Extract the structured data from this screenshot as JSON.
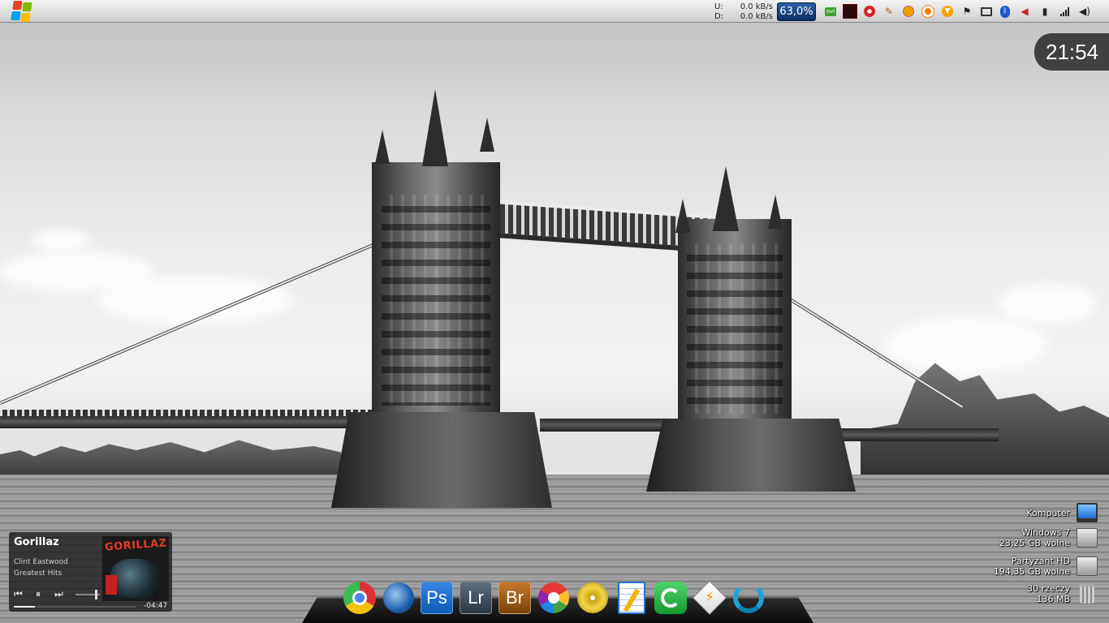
{
  "topbar": {
    "upload_label": "U:",
    "upload_speed": "0.0 kB/s",
    "download_label": "D:",
    "download_speed": "0.0 kB/s",
    "cpu_usage": "63,0%",
    "ovi_label": "ovi",
    "tray_icons": [
      "ovi-icon",
      "cpu-graph-icon",
      "antivirus-icon",
      "tools-icon",
      "coin-icon",
      "orange-sync-icon",
      "download-arrow-icon",
      "flag-icon",
      "network-icon",
      "bluetooth-icon",
      "volume-icon",
      "power-icon",
      "signal-icon",
      "speaker-icon"
    ]
  },
  "clock": {
    "time": "21:54"
  },
  "desktop_icons": [
    {
      "lines": [
        "Komputer"
      ],
      "icon": "monitor-icon"
    },
    {
      "lines": [
        "Windows 7",
        "23,25 GB wolne"
      ],
      "icon": "hard-drive-icon"
    },
    {
      "lines": [
        "Partyzant HD",
        "194,35 GB wolne"
      ],
      "icon": "hard-drive-icon"
    },
    {
      "lines": [
        "30 rzeczy",
        "136 MB"
      ],
      "icon": "recycle-bin-icon"
    }
  ],
  "player": {
    "artist": "Gorillaz",
    "track": "Clint Eastwood",
    "album": "Greatest Hits",
    "time_remaining": "-04:47",
    "cover_text": "GORILLAZ",
    "progress": 0.17
  },
  "dock": [
    {
      "name": "chrome-icon",
      "label": ""
    },
    {
      "name": "thunderbird-icon",
      "label": ""
    },
    {
      "name": "photoshop-icon",
      "label": "Ps"
    },
    {
      "name": "lightroom-icon",
      "label": "Lr"
    },
    {
      "name": "bridge-icon",
      "label": "Br"
    },
    {
      "name": "picasa-icon",
      "label": ""
    },
    {
      "name": "disc-burner-icon",
      "label": ""
    },
    {
      "name": "notepad-icon",
      "label": ""
    },
    {
      "name": "bittorrent-icon",
      "label": ""
    },
    {
      "name": "winamp-icon",
      "label": ""
    },
    {
      "name": "sync-icon",
      "label": ""
    }
  ],
  "colors": {
    "accent_blue": "#1f4a92",
    "clock_bg": "#282828",
    "photoshop": "#0a5bb5",
    "lightroom": "#3b4a57",
    "bridge": "#9b5a12"
  }
}
